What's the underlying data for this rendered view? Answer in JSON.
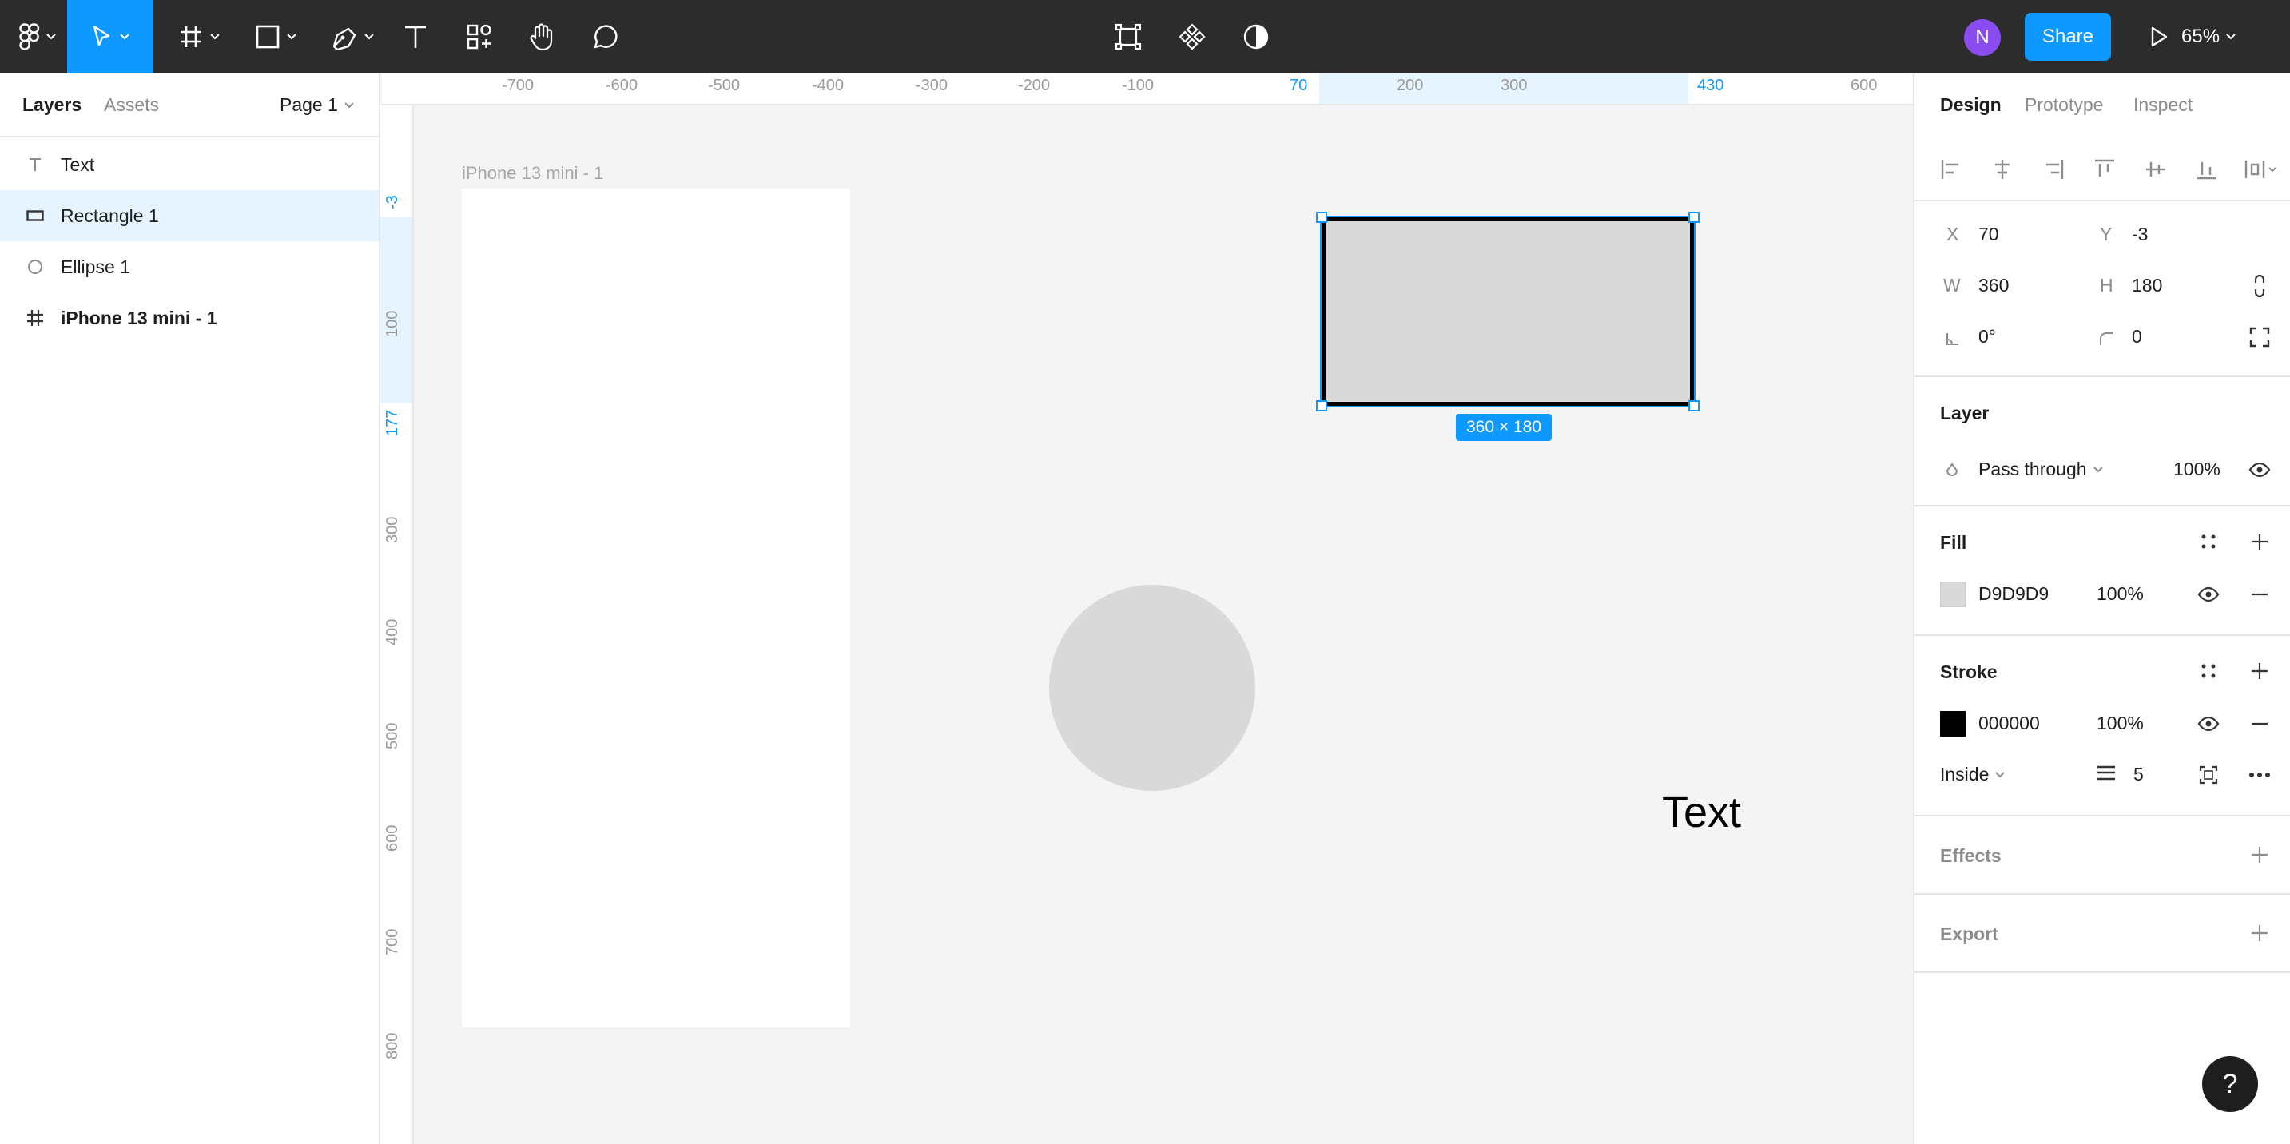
{
  "toolbar": {
    "tools": [
      "main-menu",
      "move-tool",
      "frame-tool",
      "shape-tool",
      "pen-tool",
      "text-tool",
      "resources-tool",
      "hand-tool",
      "comment-tool"
    ],
    "center_tools": [
      "edit-object",
      "components",
      "dark-mode-toggle"
    ],
    "avatar_initial": "N",
    "share_label": "Share",
    "zoom": "65%"
  },
  "left_panel": {
    "tabs": {
      "layers": "Layers",
      "assets": "Assets"
    },
    "page": "Page 1",
    "layers": [
      {
        "name": "Text",
        "icon": "text-layer-icon",
        "selected": false,
        "bold": false
      },
      {
        "name": "Rectangle 1",
        "icon": "rectangle-layer-icon",
        "selected": true,
        "bold": false
      },
      {
        "name": "Ellipse 1",
        "icon": "ellipse-layer-icon",
        "selected": false,
        "bold": false
      },
      {
        "name": "iPhone 13 mini - 1",
        "icon": "frame-layer-icon",
        "selected": false,
        "bold": true
      }
    ]
  },
  "rulers": {
    "top": [
      "-700",
      "-600",
      "-500",
      "-400",
      "-300",
      "-200",
      "-100",
      "70",
      "200",
      "300",
      "430",
      "600"
    ],
    "top_highlight": [
      "70",
      "430"
    ],
    "left": [
      "-3",
      "100",
      "177",
      "300",
      "400",
      "500",
      "600",
      "700",
      "800"
    ],
    "left_highlight": [
      "-3",
      "177"
    ]
  },
  "canvas": {
    "frame_label": "iPhone 13 mini - 1",
    "size_badge": "360 × 180",
    "text_object": "Text"
  },
  "right_panel": {
    "tabs": {
      "design": "Design",
      "prototype": "Prototype",
      "inspect": "Inspect"
    },
    "position": {
      "x_label": "X",
      "x": "70",
      "y_label": "Y",
      "y": "-3"
    },
    "size": {
      "w_label": "W",
      "w": "360",
      "h_label": "H",
      "h": "180"
    },
    "rotation": "0°",
    "radius": "0",
    "layer": {
      "title": "Layer",
      "blend": "Pass through",
      "opacity": "100%"
    },
    "fill": {
      "title": "Fill",
      "hex": "D9D9D9",
      "opacity": "100%",
      "color": "#D9D9D9"
    },
    "stroke": {
      "title": "Stroke",
      "hex": "000000",
      "opacity": "100%",
      "color": "#000000",
      "position": "Inside",
      "weight": "5"
    },
    "effects": {
      "title": "Effects"
    },
    "export": {
      "title": "Export"
    }
  },
  "help": "?"
}
